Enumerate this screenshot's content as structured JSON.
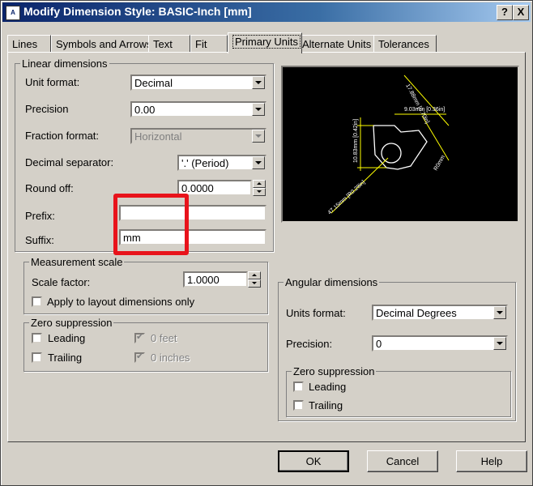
{
  "window": {
    "title": "Modify Dimension Style: BASIC-Inch [mm]",
    "help_button": "?",
    "close_button": "X"
  },
  "tabs": [
    {
      "label": "Lines"
    },
    {
      "label": "Symbols and Arrows"
    },
    {
      "label": "Text"
    },
    {
      "label": "Fit"
    },
    {
      "label": "Primary Units",
      "active": true
    },
    {
      "label": "Alternate Units"
    },
    {
      "label": "Tolerances"
    }
  ],
  "linear": {
    "group_label": "Linear dimensions",
    "unit_format_label": "Unit format:",
    "unit_format_value": "Decimal",
    "precision_label": "Precision",
    "precision_value": "0.00",
    "fraction_format_label": "Fraction format:",
    "fraction_format_value": "Horizontal",
    "decimal_separator_label": "Decimal separator:",
    "decimal_separator_value": "'.' (Period)",
    "round_off_label": "Round off:",
    "round_off_value": "0.0000",
    "prefix_label": "Prefix:",
    "prefix_value": "",
    "suffix_label": "Suffix:",
    "suffix_value": "mm"
  },
  "measurement_scale": {
    "group_label": "Measurement scale",
    "scale_factor_label": "Scale factor:",
    "scale_factor_value": "1.0000",
    "apply_layout_label": "Apply to layout dimensions only"
  },
  "zero_suppression": {
    "group_label": "Zero suppression",
    "leading_label": "Leading",
    "trailing_label": "Trailing",
    "feet_label": "0 feet",
    "inches_label": "0 inches"
  },
  "preview": {
    "labels": {
      "dim_left": "10.83mm [0.42in]",
      "dim_top": "17.88mm [0.70in]",
      "dim_mid": "9.03mm [0.36in]",
      "dim_radius": "R0mm",
      "dim_bottom": "47.15mm [R0.28in]"
    }
  },
  "angular": {
    "group_label": "Angular dimensions",
    "units_format_label": "Units format:",
    "units_format_value": "Decimal Degrees",
    "precision_label": "Precision:",
    "precision_value": "0",
    "zero_suppression_label": "Zero suppression",
    "leading_label": "Leading",
    "trailing_label": "Trailing"
  },
  "buttons": {
    "ok": "OK",
    "cancel": "Cancel",
    "help": "Help"
  },
  "colors": {
    "highlight": "#e8131b",
    "titlebar": "#0a246a",
    "dialog": "#d4d0c8",
    "preview_bg": "#000000",
    "preview_line": "#ffffff",
    "preview_dim": "#ffff00"
  }
}
